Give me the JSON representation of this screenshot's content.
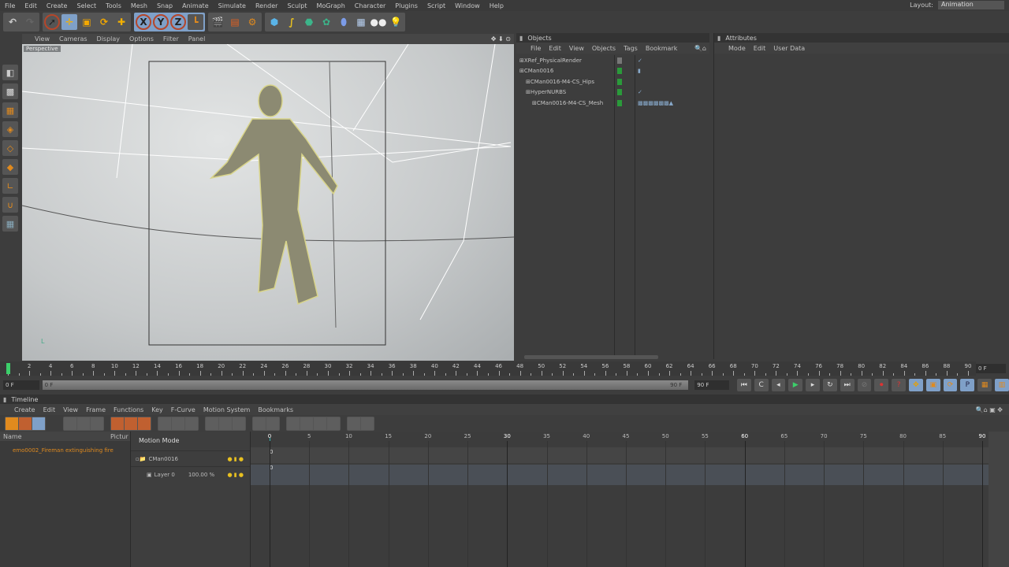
{
  "menu": [
    "File",
    "Edit",
    "Create",
    "Select",
    "Tools",
    "Mesh",
    "Snap",
    "Animate",
    "Simulate",
    "Render",
    "Sculpt",
    "MoGraph",
    "Character",
    "Plugins",
    "Script",
    "Window",
    "Help"
  ],
  "layout": {
    "label": "Layout:",
    "value": "Animation"
  },
  "toolbar_icons": [
    "undo-icon",
    "redo-icon",
    "live-select-icon",
    "move-icon",
    "scale-icon",
    "rotate-icon",
    "add-icon",
    "x-axis-icon",
    "y-axis-icon",
    "z-axis-icon",
    "coordinate-system-icon",
    "render-view-icon",
    "render-picture-viewer-icon",
    "render-settings-icon",
    "cube-icon",
    "spline-icon",
    "nurbs-icon",
    "array-icon",
    "deformer-icon",
    "floor-icon",
    "camera-icon",
    "light-icon"
  ],
  "axis_letters": [
    "X",
    "Y",
    "Z"
  ],
  "viewport": {
    "menu": [
      "View",
      "Cameras",
      "Display",
      "Options",
      "Filter",
      "Panel"
    ],
    "label": "Perspective"
  },
  "objects": {
    "title": "Objects",
    "menu": [
      "File",
      "Edit",
      "View",
      "Objects",
      "Tags",
      "Bookmark"
    ],
    "rows": [
      {
        "name": "XRef_PhysicalRender",
        "indent": 0
      },
      {
        "name": "CMan0016",
        "indent": 0
      },
      {
        "name": "CMan0016-M4-CS_Hips",
        "indent": 1
      },
      {
        "name": "HyperNURBS",
        "indent": 1
      },
      {
        "name": "CMan0016-M4-CS_Mesh",
        "indent": 2
      }
    ]
  },
  "attributes": {
    "title": "Attributes",
    "menu": [
      "Mode",
      "Edit",
      "User Data"
    ]
  },
  "ruler": {
    "start": 0,
    "end": 90,
    "step": 2
  },
  "frames": {
    "current": "0 F",
    "start": "0 F",
    "end": "90 F",
    "end_field": "90 F",
    "right_field": "0 F"
  },
  "timeline": {
    "title": "Timeline",
    "menu": [
      "Create",
      "Edit",
      "View",
      "Frame",
      "Functions",
      "Key",
      "F-Curve",
      "Motion System",
      "Bookmarks"
    ],
    "col_name": "Name",
    "col_picture": "Pictur",
    "motion_mode": "Motion Mode",
    "clip": "emo0002_Fireman extinguishing fire",
    "tracks": [
      {
        "name": "CMan0016",
        "value": "",
        "key": "0"
      },
      {
        "name": "Layer 0",
        "value": "100.00 %",
        "key": "0"
      }
    ],
    "ticks": {
      "start": 0,
      "end": 90,
      "step": 5
    }
  },
  "colors": {
    "accent": "#e08a1e",
    "play": "#3ccf6a"
  }
}
